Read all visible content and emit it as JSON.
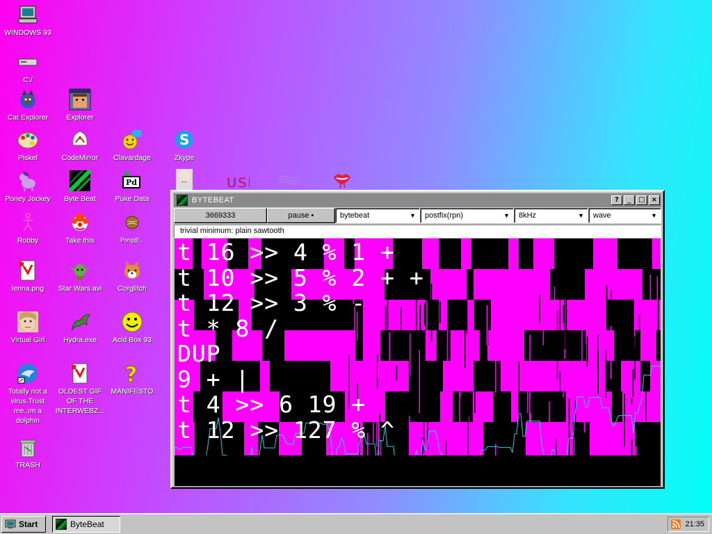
{
  "desktop": {
    "icons": [
      {
        "label": "WINDOWS 93",
        "icon": "computer-icon"
      },
      {
        "label": "C:/",
        "icon": "drive-icon"
      },
      {
        "label": "Cat Explorer",
        "icon": "cat-explorer-icon"
      },
      {
        "label": "Explorer",
        "icon": "explorer-icon"
      },
      {
        "label": "Piskel",
        "icon": "palette-icon"
      },
      {
        "label": "CodeMirror",
        "icon": "codemirror-icon"
      },
      {
        "label": "Clavardage",
        "icon": "chat-icon"
      },
      {
        "label": "Zkype",
        "icon": "zkype-icon"
      },
      {
        "label": "Poney Jockey",
        "icon": "pony-icon"
      },
      {
        "label": "Byte Beat",
        "icon": "bytebeat-icon"
      },
      {
        "label": "Puke Data",
        "icon": "puredata-icon"
      },
      {
        "label": "Robby",
        "icon": "stickman-icon"
      },
      {
        "label": "Take this",
        "icon": "clown-icon"
      },
      {
        "label": "Pong@...",
        "icon": "ball-icon"
      },
      {
        "label": "lenna.png",
        "icon": "image-file-icon"
      },
      {
        "label": "Star Wars.avi",
        "icon": "yoda-icon"
      },
      {
        "label": "Corglitch",
        "icon": "corgi-icon"
      },
      {
        "label": "Virtual Girl",
        "icon": "face-icon"
      },
      {
        "label": "Hydra.exe",
        "icon": "dragon-icon"
      },
      {
        "label": "Acid Box 93",
        "icon": "smiley-icon"
      },
      {
        "label": "Totally not a virus.Trust me..im a dolphin",
        "icon": "dolphin-icon"
      },
      {
        "label": "OLDEST GIF OF THE INTERWEBZ...",
        "icon": "gif-file-icon"
      },
      {
        "label": "MANIFESTO",
        "icon": "question-icon"
      },
      {
        "label": "TRASH",
        "icon": "trash-icon"
      }
    ]
  },
  "window": {
    "title": "BYTEBEAT",
    "buttons": {
      "help": "?",
      "minimize": "_",
      "maximize": "□",
      "close": "×"
    },
    "toolbar": {
      "counter": "3669333",
      "pause_label": "pause ▪",
      "mode": "bytebeat",
      "notation": "postfix(rpn)",
      "rate": "8kHz",
      "view": "wave"
    },
    "hint": "trivial minimum: plain sawtooth",
    "code": "t 16 >> 4 % 1 +\nt 10 >> 5 % 2 + +\nt 12 >> 3 % -\nt * 8 /\nDUP\n9 + |\nt 4 >> 6 19 +\nt 12 >> 127 % ^",
    "colors": {
      "wave_fill": "#ff00ff",
      "wave_line": "#22d3e6",
      "background": "#000000"
    }
  },
  "taskbar": {
    "start_label": "Start",
    "task_label": "ByteBeat",
    "clock": "21:35"
  }
}
